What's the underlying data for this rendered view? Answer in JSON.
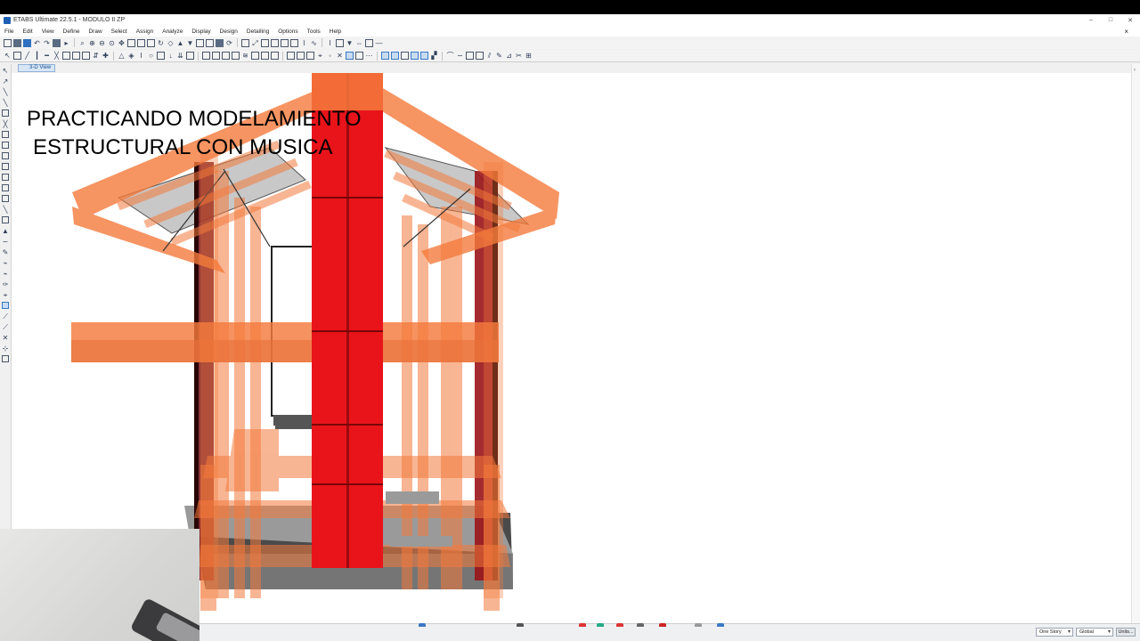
{
  "window": {
    "title": "ETABS Ultimate 22.5.1 - MODULO II ZP",
    "controls": [
      "–",
      "□",
      "✕"
    ]
  },
  "menu": {
    "items": [
      "File",
      "Edit",
      "View",
      "Define",
      "Draw",
      "Select",
      "Assign",
      "Analyze",
      "Display",
      "Design",
      "Detailing",
      "Options",
      "Tools",
      "Help"
    ],
    "close": "×"
  },
  "view_tab": {
    "label": "3-D View"
  },
  "overlay": {
    "line1": "PRACTICANDO MODELAMIENTO",
    "line2": "ESTRUCTURAL CON MUSICA"
  },
  "statusbar": {
    "story_select": "One Story",
    "coord_select": "Global",
    "units_button": "Units..."
  },
  "colors": {
    "beam_orange": "#f47a3c",
    "column_red": "#e8141a",
    "slab_gray": "#8a8a8a",
    "accent_blue": "#2f6fc0"
  }
}
